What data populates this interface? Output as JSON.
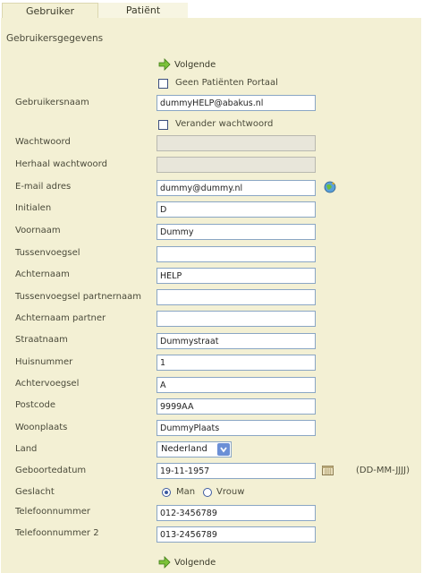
{
  "tabs": {
    "user": "Gebruiker",
    "patient": "Patiënt"
  },
  "section_title": "Gebruikersgegevens",
  "next_label": "Volgende",
  "checkboxes": {
    "no_portal": "Geen Patiënten Portaal",
    "change_password": "Verander wachtwoord"
  },
  "fields": {
    "username": {
      "label": "Gebruikersnaam",
      "value": "dummyHELP@abakus.nl"
    },
    "password": {
      "label": "Wachtwoord",
      "value": ""
    },
    "password_repeat": {
      "label": "Herhaal wachtwoord",
      "value": ""
    },
    "email": {
      "label": "E-mail adres",
      "value": "dummy@dummy.nl"
    },
    "initials": {
      "label": "Initialen",
      "value": "D"
    },
    "first_name": {
      "label": "Voornaam",
      "value": "Dummy"
    },
    "infix": {
      "label": "Tussenvoegsel",
      "value": ""
    },
    "last_name": {
      "label": "Achternaam",
      "value": "HELP"
    },
    "partner_infix": {
      "label": "Tussenvoegsel partnernaam",
      "value": ""
    },
    "partner_last_name": {
      "label": "Achternaam partner",
      "value": ""
    },
    "street": {
      "label": "Straatnaam",
      "value": "Dummystraat"
    },
    "house_number": {
      "label": "Huisnummer",
      "value": "1"
    },
    "suffix": {
      "label": "Achtervoegsel",
      "value": "A"
    },
    "postcode": {
      "label": "Postcode",
      "value": "9999AA"
    },
    "city": {
      "label": "Woonplaats",
      "value": "DummyPlaats"
    },
    "country": {
      "label": "Land",
      "value": "Nederland"
    },
    "birthdate": {
      "label": "Geboortedatum",
      "value": "19-11-1957",
      "format_hint": "(DD-MM-JJJJ)"
    },
    "gender": {
      "label": "Geslacht",
      "option_male": "Man",
      "option_female": "Vrouw",
      "selected": "Man"
    },
    "phone": {
      "label": "Telefoonnummer",
      "value": "012-3456789"
    },
    "phone2": {
      "label": "Telefoonnummer 2",
      "value": "013-2456789"
    }
  },
  "colors": {
    "panel": "#f3f0d4",
    "input_border": "#8aa6c4",
    "accent_green": "#6aaa2a"
  }
}
